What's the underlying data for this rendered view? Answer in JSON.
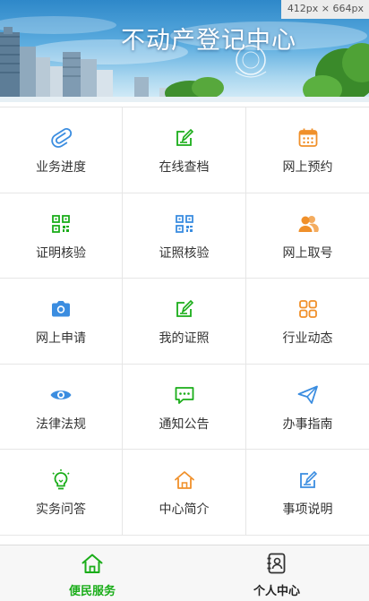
{
  "banner": {
    "title": "不动产登记中心",
    "size_hint": "412px × 664px"
  },
  "colors": {
    "blue": "#3b8de0",
    "green": "#1aad19",
    "orange": "#f0902a",
    "active_tab": "#1aad19"
  },
  "menu": [
    {
      "label": "业务进度",
      "icon": "paperclip-icon",
      "color": "#3b8de0"
    },
    {
      "label": "在线查档",
      "icon": "edit-note-icon",
      "color": "#1aad19"
    },
    {
      "label": "网上预约",
      "icon": "calendar-icon",
      "color": "#f0902a"
    },
    {
      "label": "证明核验",
      "icon": "qrcode-icon",
      "color": "#1aad19"
    },
    {
      "label": "证照核验",
      "icon": "qrcode-icon",
      "color": "#3b8de0"
    },
    {
      "label": "网上取号",
      "icon": "users-icon",
      "color": "#f0902a"
    },
    {
      "label": "网上申请",
      "icon": "camera-icon",
      "color": "#3b8de0"
    },
    {
      "label": "我的证照",
      "icon": "edit-note-icon",
      "color": "#1aad19"
    },
    {
      "label": "行业动态",
      "icon": "apps-grid-icon",
      "color": "#f0902a"
    },
    {
      "label": "法律法规",
      "icon": "eye-icon",
      "color": "#3b8de0"
    },
    {
      "label": "通知公告",
      "icon": "message-icon",
      "color": "#1aad19"
    },
    {
      "label": "办事指南",
      "icon": "send-icon",
      "color": "#3b8de0"
    },
    {
      "label": "实务问答",
      "icon": "lightbulb-icon",
      "color": "#1aad19"
    },
    {
      "label": "中心简介",
      "icon": "home-icon",
      "color": "#f0902a"
    },
    {
      "label": "事项说明",
      "icon": "edit-note-icon",
      "color": "#3b8de0"
    }
  ],
  "tabbar": {
    "tabs": [
      {
        "label": "便民服务",
        "icon": "home-icon",
        "active": true
      },
      {
        "label": "个人中心",
        "icon": "contact-book-icon",
        "active": false
      }
    ]
  }
}
